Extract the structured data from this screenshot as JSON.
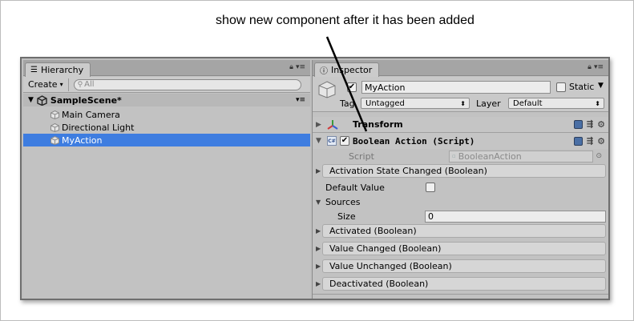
{
  "annotation": "show new component after it has been added",
  "hierarchy": {
    "tab_label": "Hierarchy",
    "create_label": "Create",
    "search_placeholder": "All",
    "scene_name": "SampleScene*",
    "items": [
      "Main Camera",
      "Directional Light",
      "MyAction"
    ],
    "selected_index": 2
  },
  "inspector": {
    "tab_label": "Inspector",
    "object_name": "MyAction",
    "static_label": "Static",
    "tag_label": "Tag",
    "tag_value": "Untagged",
    "layer_label": "Layer",
    "layer_value": "Default",
    "transform_label": "Transform",
    "component_label": "Boolean Action (Script)",
    "script_label": "Script",
    "script_value": "BooleanAction",
    "activation_state_changed": "Activation State Changed (Boolean)",
    "default_value_label": "Default Value",
    "sources_label": "Sources",
    "size_label": "Size",
    "size_value": "0",
    "events": [
      "Activated (Boolean)",
      "Value Changed (Boolean)",
      "Value Unchanged (Boolean)",
      "Deactivated (Boolean)"
    ]
  },
  "colors": {
    "selection": "#3e7de0",
    "panel": "#c2c2c2"
  }
}
